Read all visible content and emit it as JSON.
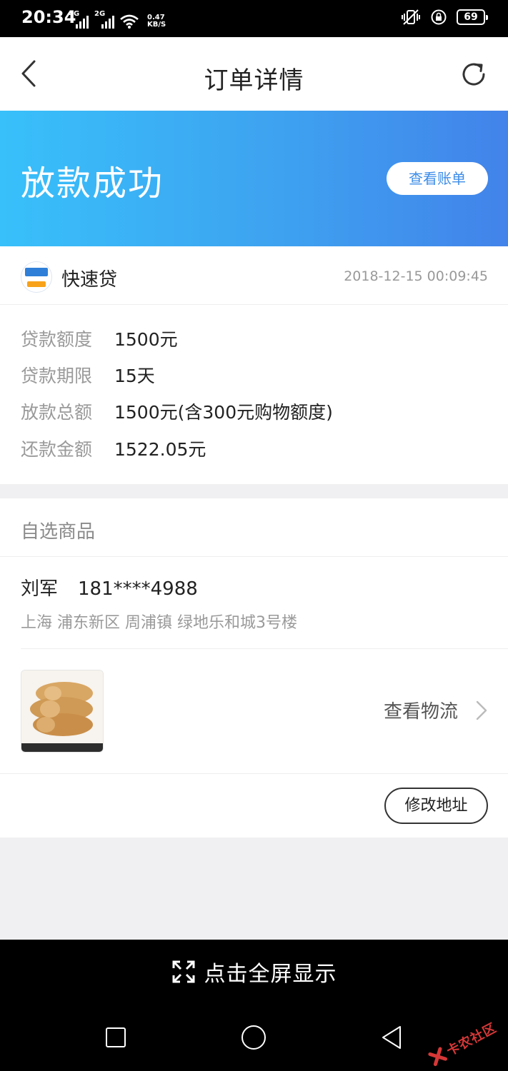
{
  "status_bar": {
    "time": "20:34",
    "network_1": "4G",
    "network_2": "2G",
    "speed_value": "0.47",
    "speed_unit": "KB/S",
    "battery": "69"
  },
  "header": {
    "title": "订单详情",
    "back_icon": "chevron-left-icon",
    "refresh_icon": "refresh-icon"
  },
  "hero": {
    "status_title": "放款成功",
    "view_bill_label": "查看账单",
    "gradient": [
      "#38c0fa",
      "#4283ea"
    ]
  },
  "merchant": {
    "name": "快速贷",
    "datetime": "2018-12-15 00:09:45"
  },
  "loan_details": [
    {
      "label": "贷款额度",
      "value": "1500元"
    },
    {
      "label": "贷款期限",
      "value": "15天"
    },
    {
      "label": "放款总额",
      "value": "1500元(含300元购物额度)"
    },
    {
      "label": "还款金额",
      "value": "1522.05元"
    }
  ],
  "goods": {
    "section_title": "自选商品",
    "recipient_name": "刘军",
    "recipient_phone": "181****4988",
    "address": "上海 浦东新区 周浦镇 绿地乐和城3号楼",
    "view_logistics_label": "查看物流",
    "edit_address_label": "修改地址"
  },
  "fullscreen": {
    "label": "点击全屏显示"
  },
  "watermark": {
    "text": "卡农社区"
  },
  "colors": {
    "accent_blue": "#3d8de8",
    "secondary_text": "#9a9a9a",
    "watermark_red": "#e23a3a"
  }
}
